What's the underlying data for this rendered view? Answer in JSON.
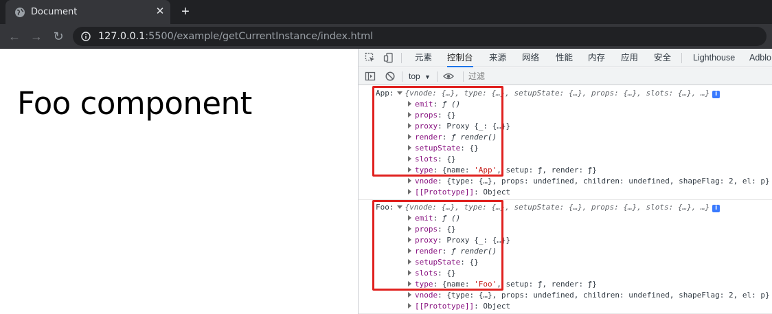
{
  "browser": {
    "tab_title": "Document",
    "url_host": "127.0.0.1",
    "url_rest": ":5500/example/getCurrentInstance/index.html"
  },
  "page": {
    "heading": "Foo component"
  },
  "devtools": {
    "tabs": [
      "元素",
      "控制台",
      "来源",
      "网络",
      "性能",
      "内存",
      "应用",
      "安全",
      "Lighthouse",
      "Adblo"
    ],
    "active_tab": "控制台",
    "context": "top",
    "filter_placeholder": "过滤",
    "messages": [
      {
        "label": "App:",
        "summary": "{vnode: {…}, type: {…}, setupState: {…}, props: {…}, slots: {…}, …}",
        "props": [
          {
            "key": "emit",
            "value": "ƒ ()"
          },
          {
            "key": "props",
            "value": "{}"
          },
          {
            "key": "proxy",
            "value": "Proxy {_: {…}}"
          },
          {
            "key": "render",
            "value": "ƒ render()"
          },
          {
            "key": "setupState",
            "value": "{}"
          },
          {
            "key": "slots",
            "value": "{}"
          },
          {
            "key": "type",
            "value_pre": "{name: ",
            "value_str": "'App'",
            "value_post": ", setup: ƒ, render: ƒ}"
          },
          {
            "key": "vnode",
            "value": "{type: {…}, props: undefined, children: undefined, shapeFlag: 2, el: p}"
          },
          {
            "key": "[[Prototype]]",
            "value": "Object"
          }
        ]
      },
      {
        "label": "Foo:",
        "summary": "{vnode: {…}, type: {…}, setupState: {…}, props: {…}, slots: {…}, …}",
        "props": [
          {
            "key": "emit",
            "value": "ƒ ()"
          },
          {
            "key": "props",
            "value": "{}"
          },
          {
            "key": "proxy",
            "value": "Proxy {_: {…}}"
          },
          {
            "key": "render",
            "value": "ƒ render()"
          },
          {
            "key": "setupState",
            "value": "{}"
          },
          {
            "key": "slots",
            "value": "{}"
          },
          {
            "key": "type",
            "value_pre": "{name: ",
            "value_str": "'Foo'",
            "value_post": ", setup: ƒ, render: ƒ}"
          },
          {
            "key": "vnode",
            "value": "{type: {…}, props: undefined, children: undefined, shapeFlag: 2, el: p}"
          },
          {
            "key": "[[Prototype]]",
            "value": "Object"
          }
        ]
      }
    ]
  },
  "colors": {
    "highlight": "#e0201e",
    "active_tab_underline": "#1a73e8",
    "key": "#881280",
    "string": "#c41a16"
  }
}
